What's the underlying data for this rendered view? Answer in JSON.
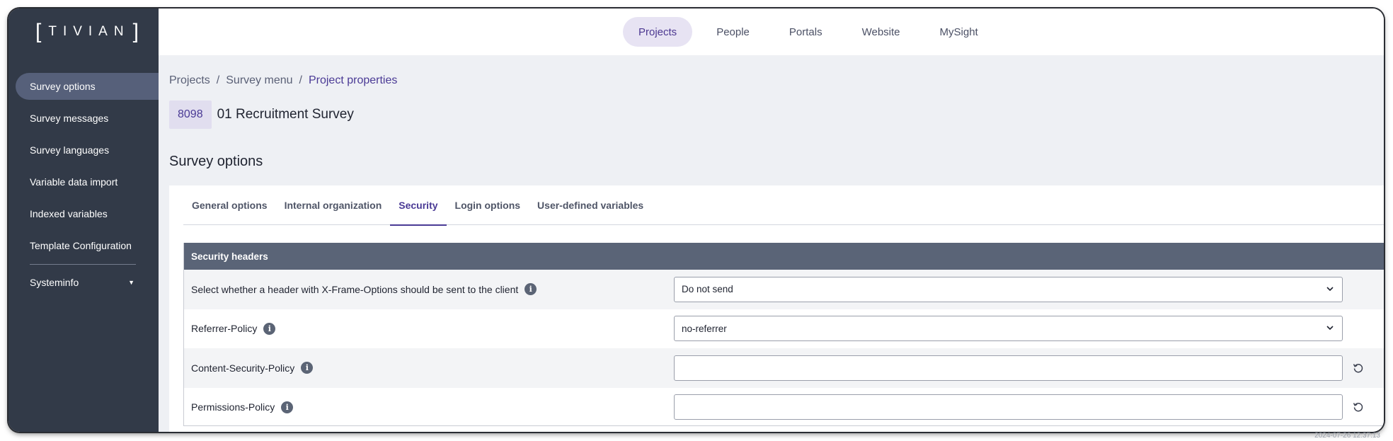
{
  "brand": {
    "logo_text": "TIVIAN"
  },
  "sidebar": {
    "items": [
      {
        "label": "Survey options",
        "active": true
      },
      {
        "label": "Survey messages",
        "active": false
      },
      {
        "label": "Survey languages",
        "active": false
      },
      {
        "label": "Variable data import",
        "active": false
      },
      {
        "label": "Indexed variables",
        "active": false
      },
      {
        "label": "Template Configuration",
        "active": false
      }
    ],
    "systeminfo": {
      "label": "Systeminfo",
      "icon": "caret-down-icon"
    }
  },
  "topnav": {
    "tabs": [
      {
        "label": "Projects",
        "active": true
      },
      {
        "label": "People",
        "active": false
      },
      {
        "label": "Portals",
        "active": false
      },
      {
        "label": "Website",
        "active": false
      },
      {
        "label": "MySight",
        "active": false
      }
    ]
  },
  "breadcrumb": {
    "items": [
      "Projects",
      "Survey menu",
      "Project properties"
    ],
    "separator": "/"
  },
  "project": {
    "id": "8098",
    "name": "01 Recruitment Survey"
  },
  "page_title": "Survey options",
  "tabs": [
    {
      "label": "General options",
      "active": false
    },
    {
      "label": "Internal organization",
      "active": false
    },
    {
      "label": "Security",
      "active": true
    },
    {
      "label": "Login options",
      "active": false
    },
    {
      "label": "User-defined variables",
      "active": false
    }
  ],
  "security": {
    "header": "Security headers",
    "rows": [
      {
        "label": "Select whether a header with X-Frame-Options should be sent to the client",
        "type": "select",
        "value": "Do not send"
      },
      {
        "label": "Referrer-Policy",
        "type": "select",
        "value": "no-referrer"
      },
      {
        "label": "Content-Security-Policy",
        "type": "input",
        "value": ""
      },
      {
        "label": "Permissions-Policy",
        "type": "input",
        "value": ""
      }
    ]
  },
  "footer": {
    "timestamp": "2024-07-26 12:37:13"
  },
  "colors": {
    "sidebar_bg": "#323a48",
    "accent": "#4a3a95",
    "section_header_bg": "#5a6477",
    "active_tab_bg": "#e7e3f3"
  }
}
